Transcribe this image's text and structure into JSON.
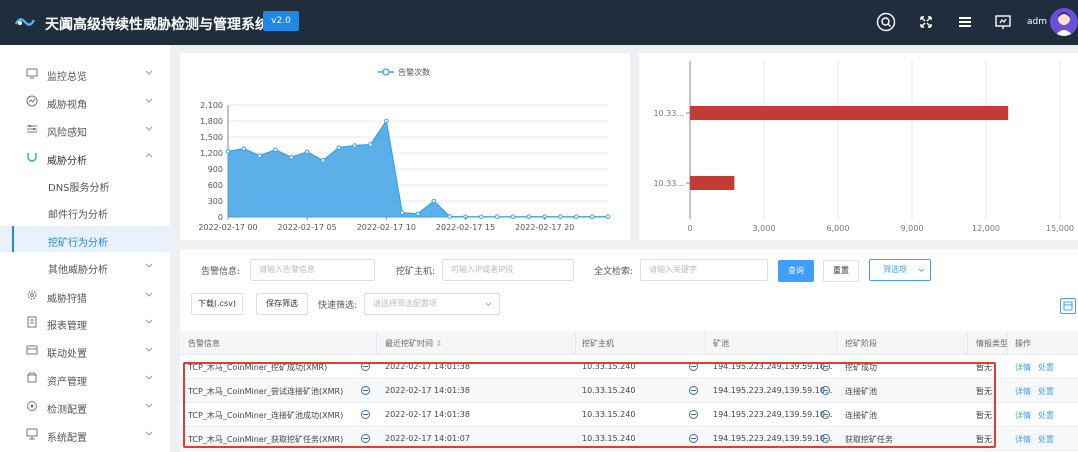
{
  "header": {
    "app_title": "天阗高级持续性威胁检测与管理系统",
    "version": "v2.0",
    "username": "adm"
  },
  "sidebar": {
    "items": [
      {
        "label": "监控总览",
        "icon": "monitor-icon"
      },
      {
        "label": "威胁视角",
        "icon": "radar-icon"
      },
      {
        "label": "风险感知",
        "icon": "sliders-icon"
      },
      {
        "label": "威胁分析",
        "icon": "magnet-icon"
      },
      {
        "label": "DNS服务分析"
      },
      {
        "label": "邮件行为分析"
      },
      {
        "label": "挖矿行为分析"
      },
      {
        "label": "其他威胁分析"
      },
      {
        "label": "威胁狩猎",
        "icon": "gear-icon"
      },
      {
        "label": "报表管理",
        "icon": "report-icon"
      },
      {
        "label": "联动处置",
        "icon": "link-icon"
      },
      {
        "label": "资产管理",
        "icon": "asset-icon"
      },
      {
        "label": "检测配置",
        "icon": "config-icon"
      },
      {
        "label": "系统配置",
        "icon": "computer-icon"
      }
    ]
  },
  "line_chart": {
    "legend": "告警次数",
    "color": "#3fa2e6",
    "chart_data": {
      "type": "area",
      "series": [
        {
          "name": "告警次数",
          "values": [
            1230,
            1280,
            1150,
            1260,
            1120,
            1220,
            1060,
            1300,
            1340,
            1360,
            1800,
            80,
            60,
            300,
            10,
            5,
            5,
            5,
            5,
            5,
            5,
            5,
            5,
            5,
            5
          ]
        }
      ],
      "x_tick_labels": [
        "2022-02-17 00",
        "2022-02-17 05",
        "2022-02-17 10",
        "2022-02-17 15",
        "2022-02-17 20"
      ],
      "y_tick_labels": [
        "0",
        "300",
        "600",
        "900",
        "1,200",
        "1,500",
        "1,800",
        "2,100"
      ],
      "ylim": [
        0,
        2100
      ]
    }
  },
  "bar_chart": {
    "color": "#c43a34",
    "chart_data": {
      "type": "bar",
      "orientation": "horizontal",
      "categories": [
        "10.33...",
        "10.33..."
      ],
      "values": [
        12900,
        1800
      ],
      "x_tick_labels": [
        "0",
        "3,000",
        "6,000",
        "9,000",
        "12,000",
        "15,000"
      ],
      "xlim": [
        0,
        15000
      ]
    }
  },
  "filters": {
    "alert_label": "告警信息:",
    "alert_placeholder": "请输入告警信息",
    "host_label": "挖矿主机:",
    "host_placeholder": "可输入IP或者IP段",
    "fulltext_label": "全文检索:",
    "fulltext_placeholder": "请输入关键字",
    "query_button": "查询",
    "reset_button": "重置",
    "options_button": "筛选项",
    "download_button": "下载(.csv)",
    "save_filter_button": "保存筛选",
    "quick_filter_label": "快速筛选:",
    "quick_filter_placeholder": "请选择筛选配置项"
  },
  "table": {
    "columns": [
      "告警信息",
      "最近挖矿时间",
      "挖矿主机",
      "矿池",
      "挖矿阶段",
      "情报类型",
      "操作"
    ],
    "rows": [
      {
        "alert": "TCP_木马_CoinMiner_挖矿成功(XMR)",
        "time": "2022-02-17 14:01:38",
        "host": "10.33.15.240",
        "pool": "194.195.223.249,139.59.10...",
        "stage": "挖矿成功",
        "intel": "暂无",
        "detail": "详情",
        "dispose": "处置"
      },
      {
        "alert": "TCP_木马_CoinMiner_尝试连接矿池(XMR)",
        "time": "2022-02-17 14:01:38",
        "host": "10.33.15.240",
        "pool": "194.195.223.249,139.59.10...",
        "stage": "连接矿池",
        "intel": "暂无",
        "detail": "详情",
        "dispose": "处置"
      },
      {
        "alert": "TCP_木马_CoinMiner_连接矿池成功(XMR)",
        "time": "2022-02-17 14:01:38",
        "host": "10.33.15.240",
        "pool": "194.195.223.249,139.59.10...",
        "stage": "连接矿池",
        "intel": "暂无",
        "detail": "详情",
        "dispose": "处置"
      },
      {
        "alert": "TCP_木马_CoinMiner_获取挖矿任务(XMR)",
        "time": "2022-02-17 14:01:07",
        "host": "10.33.15.240",
        "pool": "194.195.223.249,139.59.10...",
        "stage": "获取挖矿任务",
        "intel": "暂无",
        "detail": "详情",
        "dispose": "处置"
      }
    ]
  },
  "colors": {
    "accent": "#409eff",
    "header_bg": "#1f2d3d",
    "highlight": "#e53935"
  }
}
